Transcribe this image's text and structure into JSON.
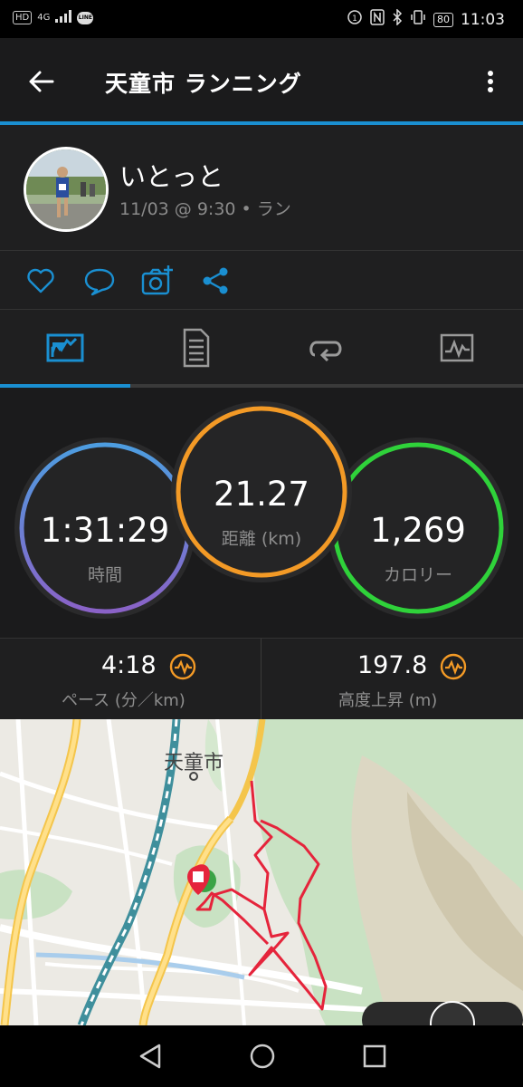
{
  "status_bar": {
    "left_text": "HD",
    "network": "4G",
    "app_tag": "LINE",
    "battery": "80",
    "time": "11:03"
  },
  "app_bar": {
    "title": "天童市 ランニング"
  },
  "profile": {
    "name": "いとっと",
    "meta": "11/03 @ 9:30 • ラン"
  },
  "social_icons": [
    "heart-icon",
    "comment-icon",
    "camera-add-icon",
    "share-icon"
  ],
  "tabs": [
    "summary-tab",
    "details-tab",
    "laps-tab",
    "chart-tab"
  ],
  "rings": {
    "time": {
      "value": "1:31:29",
      "label": "時間",
      "color": "#5b8fd6"
    },
    "distance": {
      "value": "21.27",
      "label": "距離",
      "unit": "(km)",
      "color": "#f39a26"
    },
    "calories": {
      "value": "1,269",
      "label": "カロリー",
      "color": "#2fd23a"
    }
  },
  "stats": {
    "pace": {
      "value": "4:18",
      "label": "ペース (分／km)"
    },
    "elevation": {
      "value": "197.8",
      "label": "高度上昇 (m)"
    }
  },
  "map": {
    "city_label": "天童市"
  },
  "colors": {
    "accent": "#1a8fd1",
    "route": "#e5243b"
  }
}
